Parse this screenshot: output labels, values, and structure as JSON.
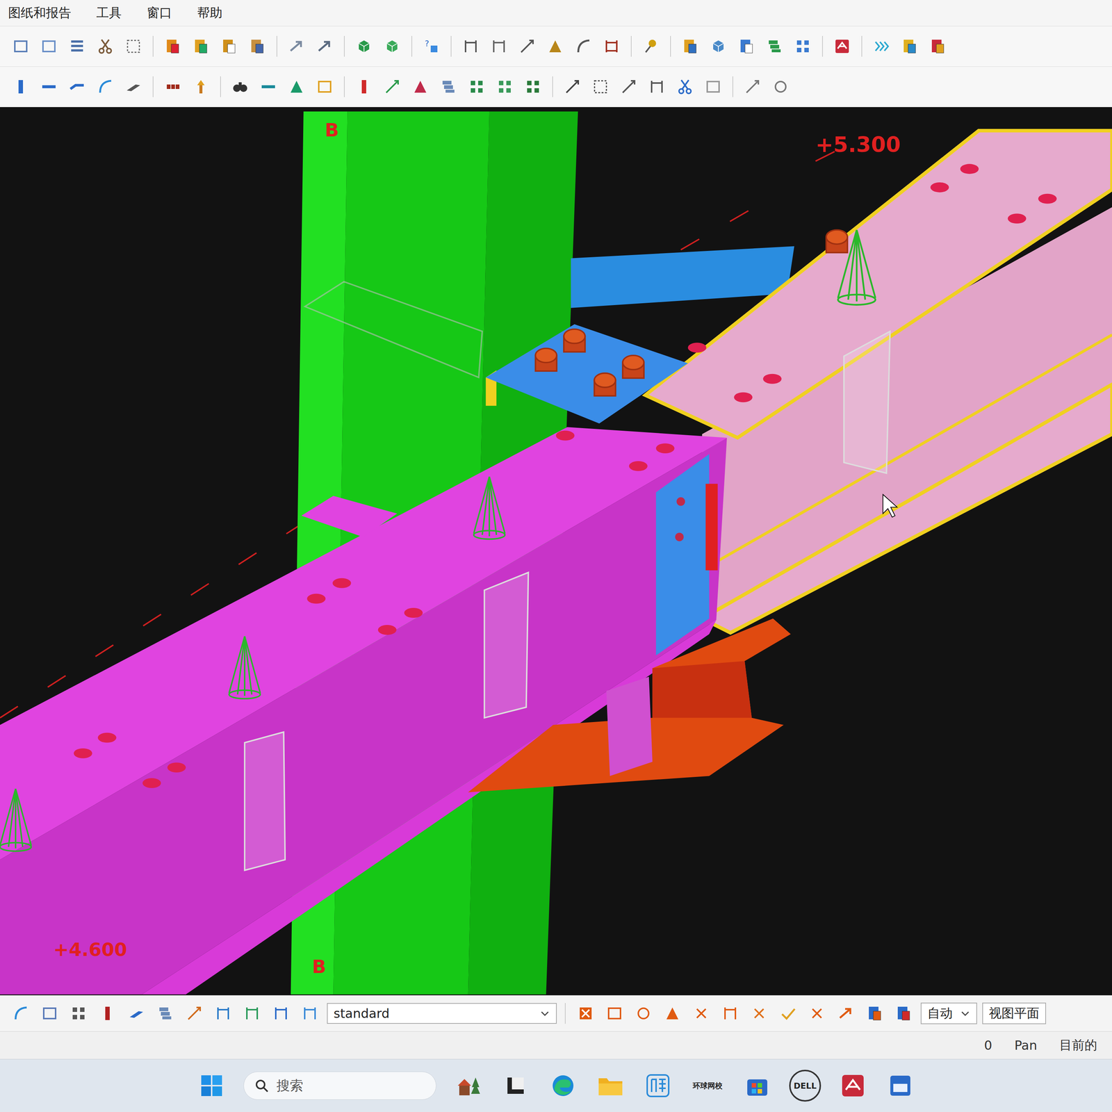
{
  "menu": [
    {
      "label": "图纸和报告"
    },
    {
      "label": "工具"
    },
    {
      "label": "窗口"
    },
    {
      "label": "帮助"
    }
  ],
  "viewport": {
    "grid_labels": [
      "B",
      "B"
    ],
    "elevations": [
      "+5.300",
      "+4.600"
    ]
  },
  "bottom_toolbar": {
    "filter": "standard"
  },
  "status_bar": {
    "snap_mode": "自动",
    "view_plane": "视图平面",
    "count": "0",
    "mode": "Pan",
    "current": "目前的"
  },
  "taskbar": {
    "search_placeholder": "搜索",
    "app_labels": [
      "环球网校",
      "DELL"
    ]
  }
}
